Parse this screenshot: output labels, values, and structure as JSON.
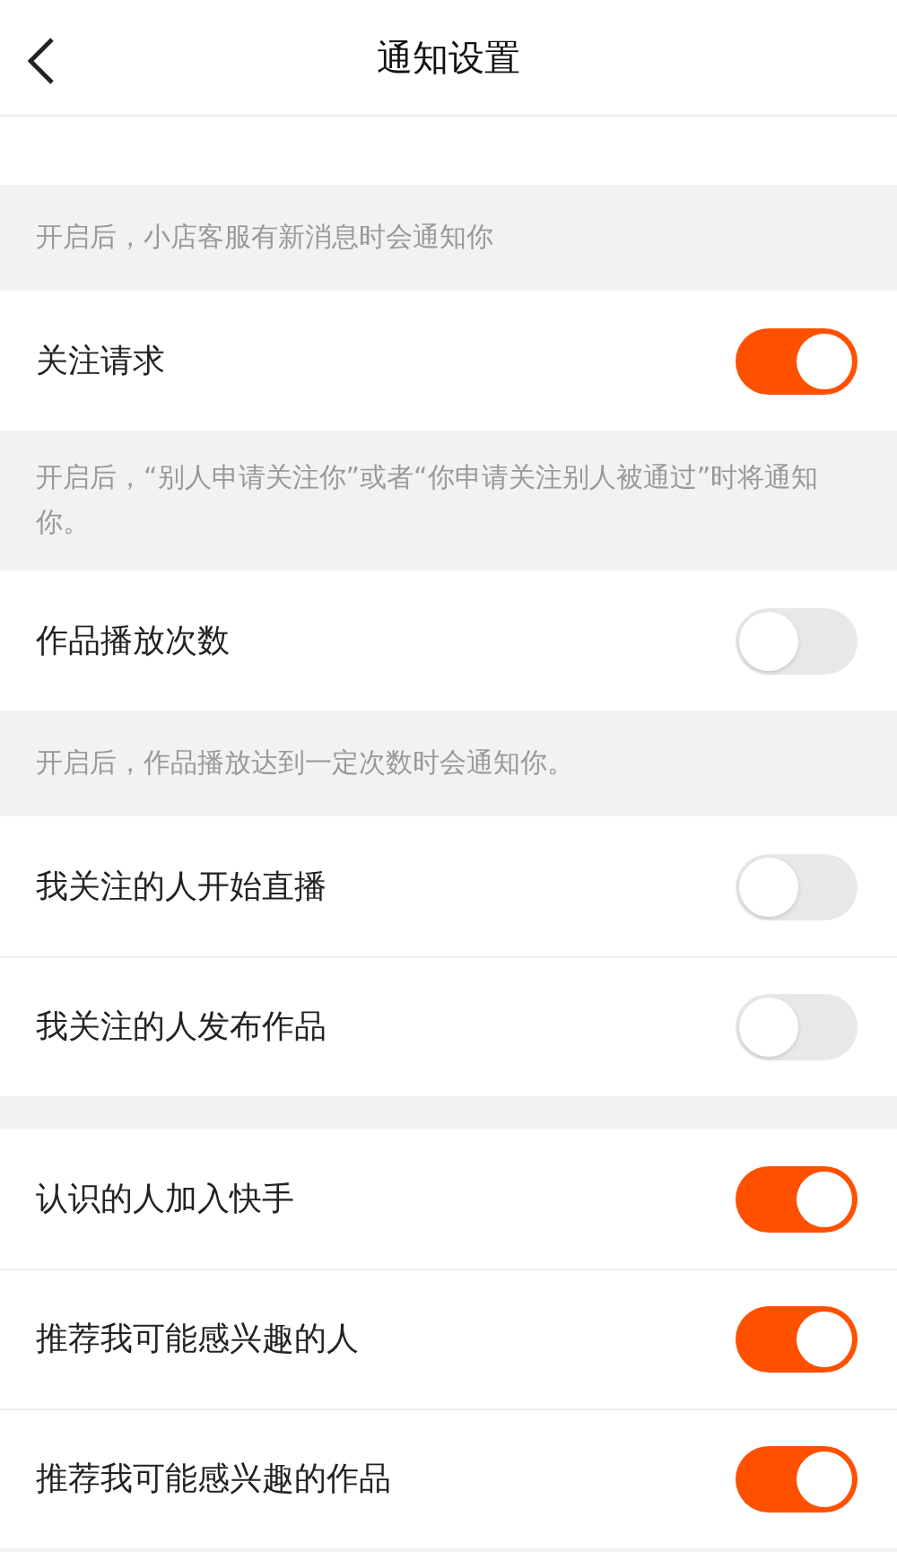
{
  "header": {
    "title": "通知设置"
  },
  "groups": [
    {
      "note": "开启后，小店客服有新消息时会通知你"
    },
    {
      "rows": [
        {
          "label": "关注请求",
          "on": true
        }
      ],
      "note": "开启后，“别人申请关注你”或者“你申请关注别人被通过”时将通知你。"
    },
    {
      "rows": [
        {
          "label": "作品播放次数",
          "on": false
        }
      ],
      "note": "开启后，作品播放达到一定次数时会通知你。"
    },
    {
      "rows": [
        {
          "label": "我关注的人开始直播",
          "on": false
        },
        {
          "label": "我关注的人发布作品",
          "on": false
        }
      ]
    },
    {
      "rows": [
        {
          "label": "认识的人加入快手",
          "on": true
        },
        {
          "label": "推荐我可能感兴趣的人",
          "on": true
        },
        {
          "label": "推荐我可能感兴趣的作品",
          "on": true
        }
      ]
    }
  ]
}
